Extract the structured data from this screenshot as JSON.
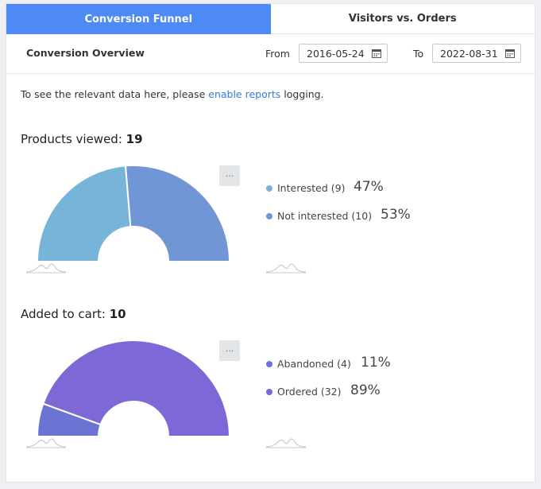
{
  "tabs": [
    {
      "label": "Conversion Funnel",
      "active": true
    },
    {
      "label": "Visitors vs. Orders",
      "active": false
    }
  ],
  "toolbar": {
    "title": "Conversion Overview",
    "from_label": "From",
    "from_value": "2016-05-24",
    "to_label": "To",
    "to_value": "2022-08-31"
  },
  "info": {
    "prefix": "To see the relevant data here, please ",
    "link": "enable reports",
    "suffix": " logging."
  },
  "menu_label": "···",
  "sections": [
    {
      "label": "Products viewed:",
      "total": "19",
      "slices": [
        {
          "label": "Interested (9)",
          "value": 9,
          "percent": "47%",
          "color": "#76b5d8"
        },
        {
          "label": "Not interested (10)",
          "value": 10,
          "percent": "53%",
          "color": "#7096d6"
        }
      ]
    },
    {
      "label": "Added to cart:",
      "total": "10",
      "slices": [
        {
          "label": "Abandoned (4)",
          "value": 4,
          "percent": "11%",
          "color": "#6b74d3"
        },
        {
          "label": "Ordered (32)",
          "value": 32,
          "percent": "89%",
          "color": "#7e67d6"
        }
      ]
    }
  ]
}
